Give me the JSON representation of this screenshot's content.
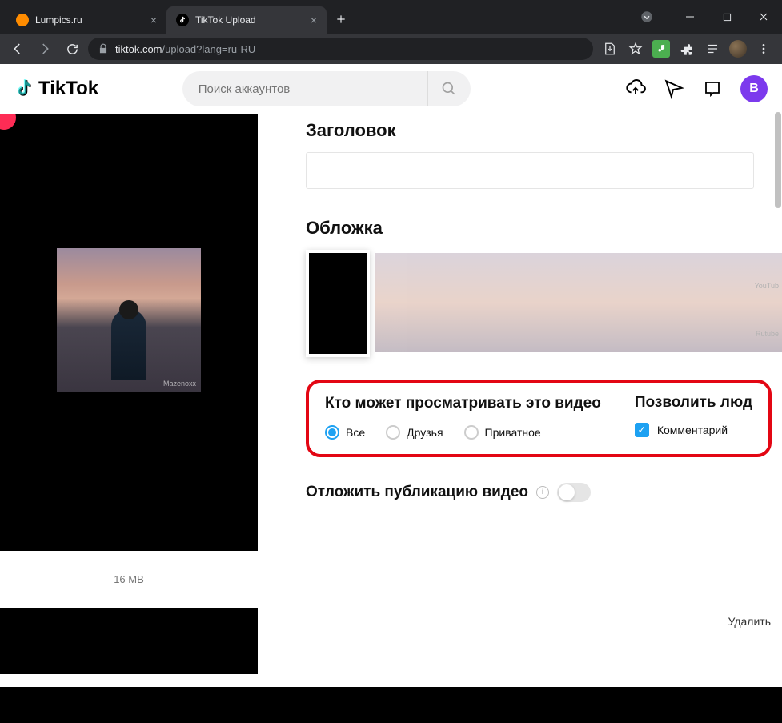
{
  "browser": {
    "tabs": [
      {
        "title": "Lumpics.ru",
        "active": false,
        "favicon_color": "#ff8c00"
      },
      {
        "title": "TikTok Upload",
        "active": true,
        "favicon": "tiktok"
      }
    ],
    "url_domain": "tiktok.com",
    "url_path": "/upload?lang=ru-RU"
  },
  "tiktok_header": {
    "brand": "TikTok",
    "search_placeholder": "Поиск аккаунтов",
    "user_initial": "B"
  },
  "upload": {
    "title_section": "Заголовок",
    "cover_section": "Обложка",
    "who_can_view_title": "Кто может просматривать это видео",
    "who_options": [
      {
        "label": "Все",
        "selected": true
      },
      {
        "label": "Друзья",
        "selected": false
      },
      {
        "label": "Приватное",
        "selected": false
      }
    ],
    "allow_title": "Позволить люд",
    "allow_comment_label": "Комментарий",
    "allow_comment_checked": true,
    "schedule_label": "Отложить публикацию видео",
    "file_size": "16 MB",
    "delete_label": "Удалить",
    "preview_watermark": "Mazenoxx",
    "cover_overlay_youtube": "YouTub",
    "cover_overlay_rutube": "Rutube"
  }
}
